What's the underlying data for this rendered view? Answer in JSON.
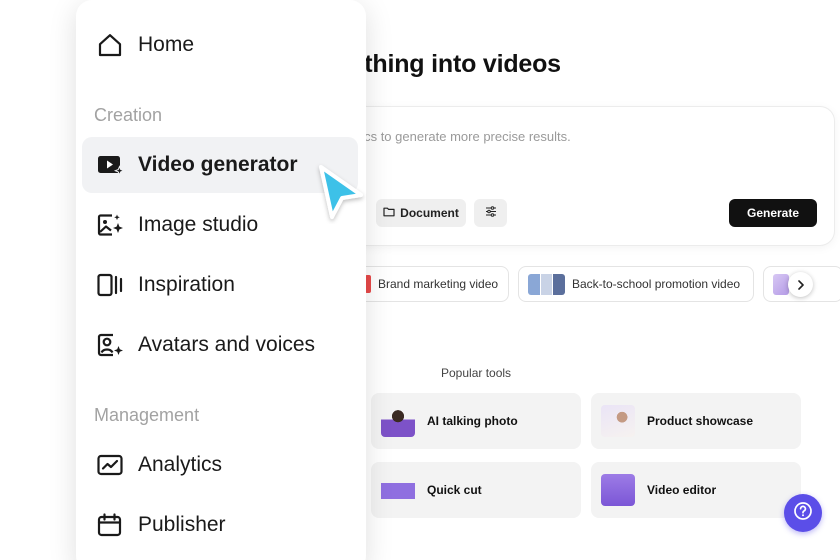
{
  "main": {
    "headline": "n anything into videos",
    "prompt": {
      "placeholder": "a, or docs to generate more precise results.",
      "document_label": "Document",
      "generate_label": "Generate"
    },
    "chips": [
      {
        "label": "Brand marketing video"
      },
      {
        "label": "Back-to-school promotion video"
      }
    ],
    "popular_tools": {
      "title": "Popular tools",
      "items": [
        {
          "label": "AI talking photo"
        },
        {
          "label": "Product showcase"
        },
        {
          "label": "Quick cut"
        },
        {
          "label": "Video editor"
        }
      ]
    }
  },
  "sidebar": {
    "home": "Home",
    "sections": [
      {
        "label": "Creation",
        "items": [
          {
            "label": "Video generator",
            "icon": "video-sparkle-icon",
            "active": true
          },
          {
            "label": "Image studio",
            "icon": "image-sparkle-icon"
          },
          {
            "label": "Inspiration",
            "icon": "inspiration-icon"
          },
          {
            "label": "Avatars and voices",
            "icon": "avatar-sparkle-icon"
          }
        ]
      },
      {
        "label": "Management",
        "items": [
          {
            "label": "Analytics",
            "icon": "analytics-icon"
          },
          {
            "label": "Publisher",
            "icon": "calendar-icon"
          }
        ]
      }
    ]
  },
  "colors": {
    "accent": "#5b4ee8",
    "cursor": "#3cc1e8",
    "active_bg": "#f1f2f4",
    "generate_bg": "#111111"
  }
}
